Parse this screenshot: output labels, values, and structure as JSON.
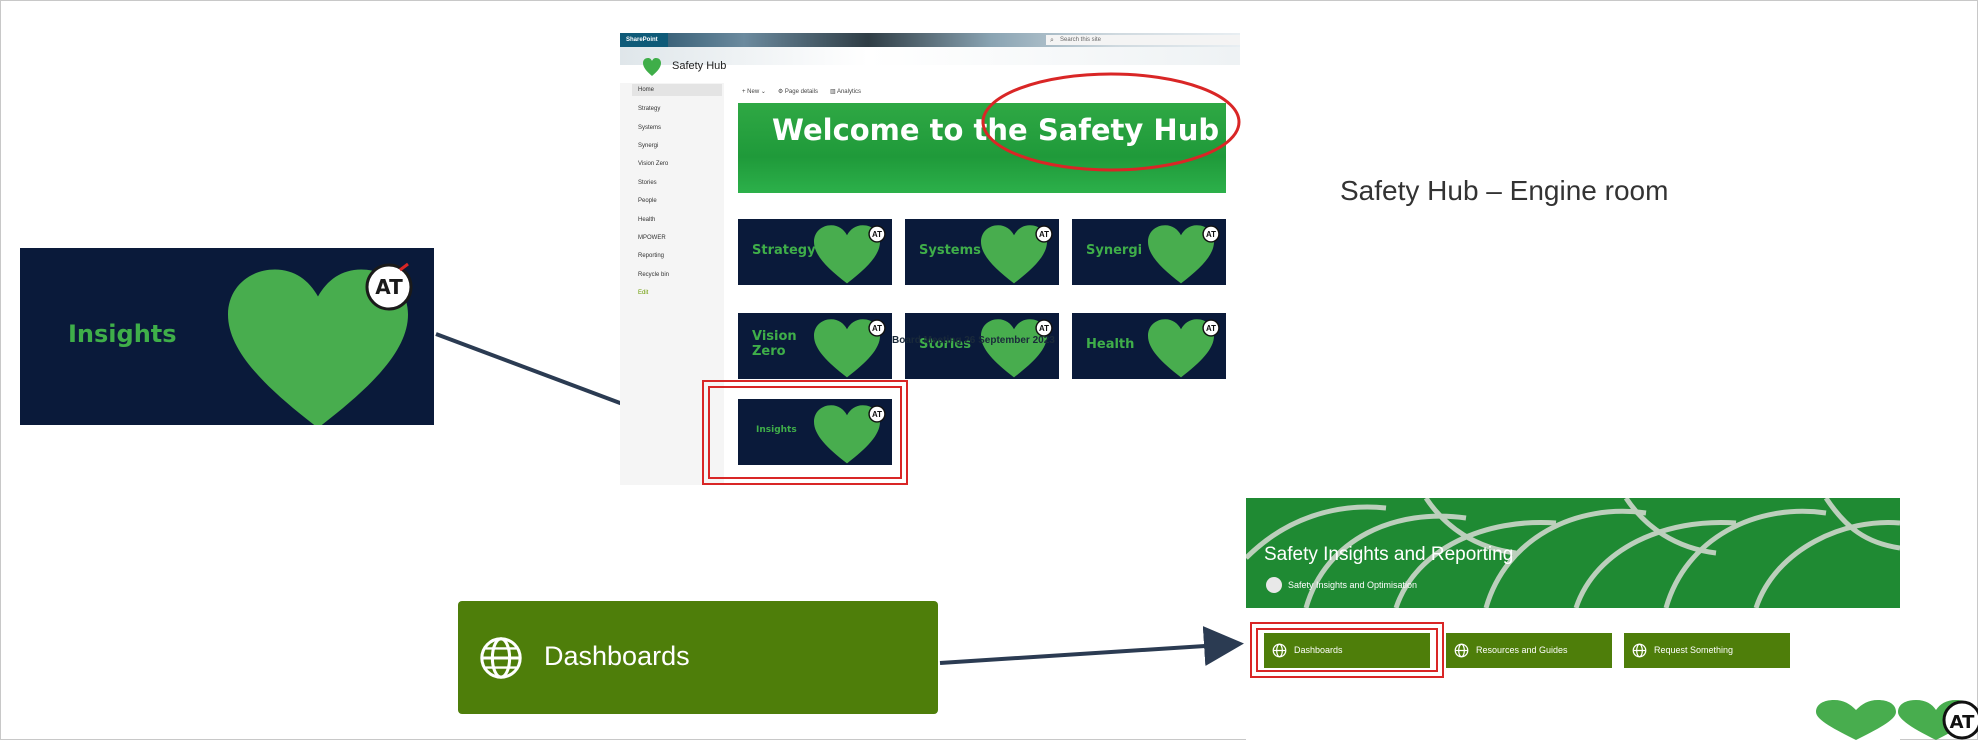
{
  "slide": {
    "heading": "Safety Hub – Engine room",
    "overlay_text": "Board Meeting 26 September 2023"
  },
  "insights_tile": {
    "label": "Insights",
    "badge": "AT"
  },
  "sharepoint": {
    "brand": "SharePoint",
    "search_placeholder": "Search this site",
    "site_title": "Safety Hub",
    "nav": [
      "Home",
      "Strategy",
      "Systems",
      "Synergi",
      "Vision Zero",
      "Stories",
      "People",
      "Health",
      "MPOWER",
      "Reporting",
      "Recycle bin",
      "Edit"
    ],
    "commands": [
      "+ New ⌄",
      "⚙ Page details",
      "▥ Analytics"
    ],
    "banner": "Welcome to the Safety Hub",
    "tiles": [
      {
        "label": "Strategy"
      },
      {
        "label": "Systems"
      },
      {
        "label": "Synergi"
      },
      {
        "label": "Vision Zero"
      },
      {
        "label": "Stories"
      },
      {
        "label": "Health"
      },
      {
        "label": "Insights"
      }
    ],
    "badge": "AT"
  },
  "dashboards_button": {
    "label": "Dashboards"
  },
  "insights_site": {
    "title": "Safety Insights and Reporting",
    "subtitle": "Safety Insights and Optimisation",
    "buttons": [
      {
        "label": "Dashboards"
      },
      {
        "label": "Resources and Guides"
      },
      {
        "label": "Request Something"
      }
    ]
  },
  "colors": {
    "tile_bg": "#0a1a3a",
    "heart": "#48ad4e",
    "button_green": "#4e7e0a",
    "annotation_red": "#d92626",
    "arrow": "#2b3b52"
  }
}
